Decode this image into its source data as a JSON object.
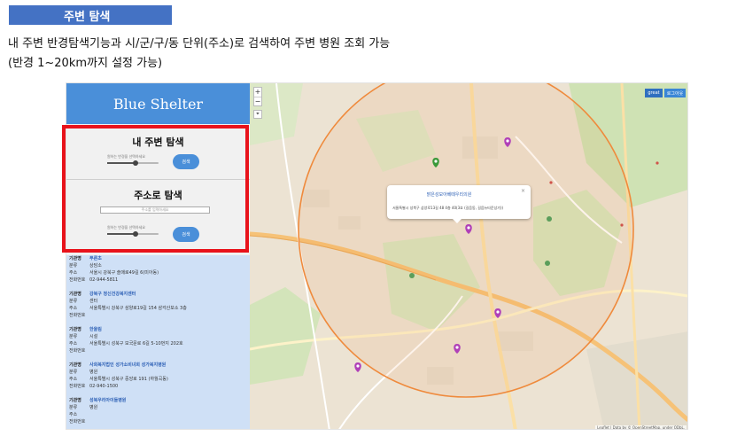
{
  "header": {
    "tag": "주변 탐색",
    "line1": "내 주변 반경탐색기능과 시/군/구/동 단위(주소)로 검색하여 주변 병원 조회 가능",
    "line2": "(반경 1~20km까지 설정 가능)"
  },
  "app": {
    "title": "Blue Shelter",
    "nearby": {
      "title": "내 주변 탐색",
      "slider_label": "원하는 반경을 선택하세요",
      "slider_value": 0.55,
      "button": "검색"
    },
    "address": {
      "title": "주소로 탐색",
      "placeholder": "주소를 입력하세요",
      "slider_label": "원하는 반경을 선택하세요",
      "slider_value": 0.55,
      "button": "검색"
    },
    "field_labels": {
      "name": "기관명",
      "category": "분류",
      "address": "주소",
      "phone": "전화번호"
    },
    "results": [
      {
        "name": "푸른초",
        "category": "상담소",
        "address": "서울시 강북구 솔매로49길 6(미아동)",
        "phone": "02-944-5811"
      },
      {
        "name": "강북구 정신건강복지센터",
        "category": "센터",
        "address": "서울특별시 강북구 삼양로19길 154 삼각산보소 3층",
        "phone": ""
      },
      {
        "name": "한울림",
        "category": "시설",
        "address": "서울특별시 성북구 보국문로 6길 5-10번지 202호",
        "phone": ""
      },
      {
        "name": "사회복지법인 성가소비녀회 성가복지병원",
        "category": "병원",
        "address": "서울특별시 성북구 중앙로 191 (하월곡동)",
        "phone": "02-940-1500"
      },
      {
        "name": "성북우리아이들병원",
        "category": "병원",
        "address": "",
        "phone": ""
      }
    ]
  },
  "map": {
    "zoom_in": "+",
    "zoom_out": "−",
    "locate": "⌖",
    "layer_btn1": "great",
    "layer_btn2": "로그아웃",
    "popup": {
      "title": "밝은성모아베떼우리의원",
      "address": "서울특별시 성북구 삼양로13길 48 4층 40(3호 (길음동, 길음뉴타운상가))",
      "close": "×"
    },
    "attribution": "Leaflet | Data by © OpenStreetMap, under ODbL.",
    "colors": {
      "circle": "#ef8a3c",
      "marker": "#b040b8",
      "marker_green": "#3a9a3a",
      "road": "#f6c277"
    }
  }
}
